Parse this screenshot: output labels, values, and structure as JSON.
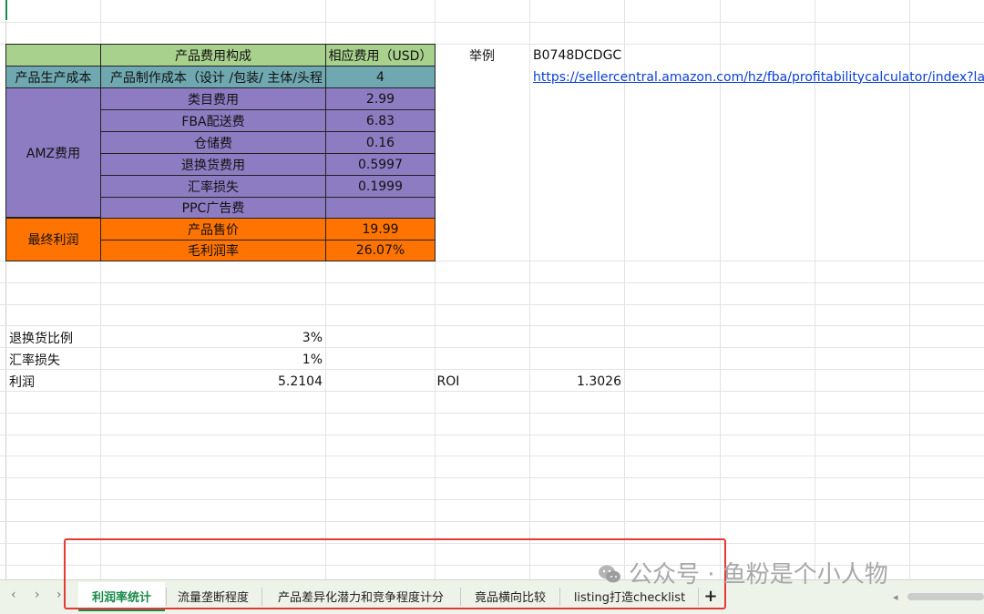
{
  "table": {
    "header_col2": "产品费用构成",
    "header_col3": "相应费用（USD）",
    "rows": [
      {
        "cat": "产品生产成本",
        "item": "产品制作成本（设计 /包装/ 主体/头程",
        "value": "4"
      },
      {
        "cat": "AMZ费用",
        "item": "类目费用",
        "value": "2.99"
      },
      {
        "item": "FBA配送费",
        "value": "6.83"
      },
      {
        "item": "仓储费",
        "value": "0.16"
      },
      {
        "item": "退换货费用",
        "value": "0.5997"
      },
      {
        "item": "汇率损失",
        "value": "0.1999"
      },
      {
        "item": "PPC广告费",
        "value": ""
      },
      {
        "cat": "最终利润",
        "item": "产品售价",
        "value": "19.99"
      },
      {
        "item": "毛利润率",
        "value": "26.07%"
      }
    ]
  },
  "example": {
    "label": "举例",
    "asin": "B0748DCDGC",
    "link": "https://sellercentral.amazon.com/hz/fba/profitabilitycalculator/index?lang=en"
  },
  "summary": {
    "return_ratio_label": "退换货比例",
    "return_ratio_value": "3%",
    "fx_loss_label": "汇率损失",
    "fx_loss_value": "1%",
    "profit_label": "利润",
    "profit_value": "5.2104",
    "roi_label": "ROI",
    "roi_value": "1.3026"
  },
  "tabs": {
    "items": [
      "利润率统计",
      "流量垄断程度",
      "产品差异化潜力和竞争程度计分",
      "竟品横向比较",
      "listing打造checklist"
    ],
    "add_label": "+",
    "nav": [
      "‹",
      "›",
      "›"
    ]
  },
  "watermark": "公众号 · 鱼粉是个小人物",
  "colors": {
    "green": "#a9d18e",
    "teal": "#6fa8b0",
    "purple": "#8e7cc3",
    "orange": "#ff7300",
    "active_tab": "#1a8a4a",
    "highlight": "#e53935"
  }
}
